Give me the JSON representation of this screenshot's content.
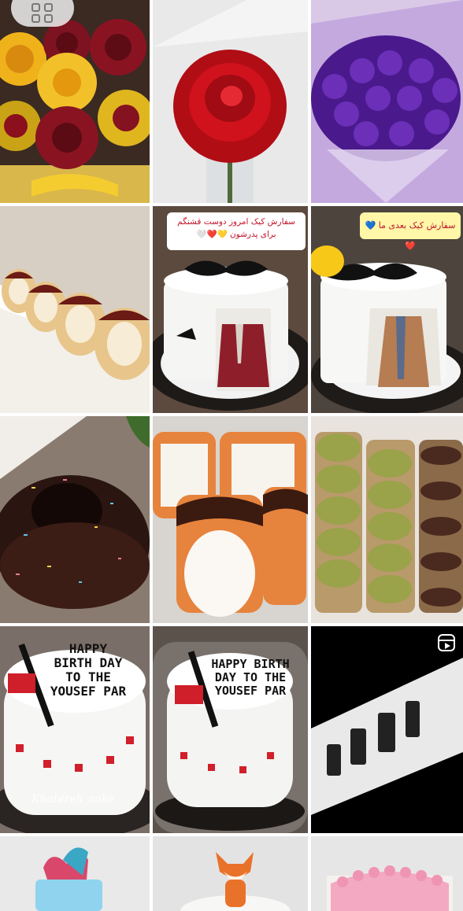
{
  "feed": {
    "tiles": [
      {
        "id": "t1",
        "subject": "ribbon-roses-yellow-maroon"
      },
      {
        "id": "t2",
        "subject": "single-red-ribbon-rose"
      },
      {
        "id": "t3",
        "subject": "purple-rose-bouquet"
      },
      {
        "id": "t4",
        "subject": "cake-roll-slices"
      },
      {
        "id": "t5",
        "subject": "fathers-day-cake",
        "caption": "سفارش کیک امروز دوست قشنگم برای پدرشون 💛❤️🤍"
      },
      {
        "id": "t6",
        "subject": "fathers-day-cake-2",
        "caption": "سفارش کیک بعدی ما 💙❤️"
      },
      {
        "id": "t7",
        "subject": "chocolate-bundt-cake"
      },
      {
        "id": "t8",
        "subject": "chocolate-drizzle-rolls"
      },
      {
        "id": "t9",
        "subject": "pistachio-roll-slices"
      },
      {
        "id": "t10",
        "subject": "birthday-cake",
        "cake_text": "HAPPY BIRTH DAY TO THE YOUSEF PAR",
        "watermark": "Khatereh_cake"
      },
      {
        "id": "t11",
        "subject": "birthday-cake-domed",
        "cake_text": "HAPPY BIRTH DAY TO THE YOUSEF PAR"
      },
      {
        "id": "t12",
        "subject": "reel-cake-letters",
        "badge": "reel-icon"
      },
      {
        "id": "t13",
        "subject": "mermaid-tail-cake"
      },
      {
        "id": "t14",
        "subject": "fox-topper-cake"
      },
      {
        "id": "t15",
        "subject": "pink-frosted-cake"
      }
    ]
  },
  "colors": {
    "bg": "#ffffff",
    "caption_bg": "#ffffff",
    "caption_text": "#c0142a"
  }
}
